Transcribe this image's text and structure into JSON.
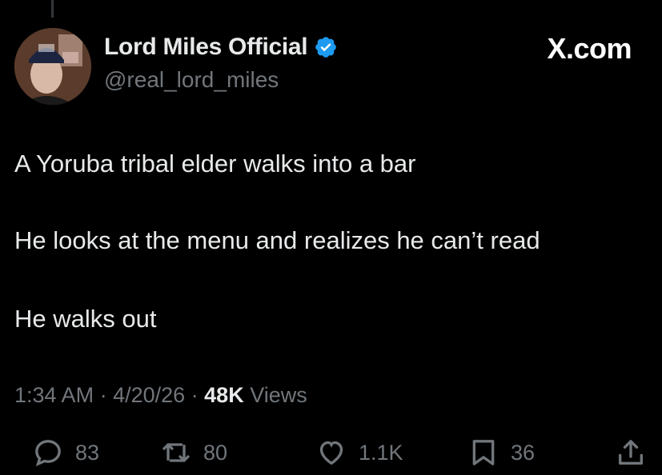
{
  "author": {
    "name": "Lord Miles Official",
    "handle": "@real_lord_miles",
    "verified": true
  },
  "site": {
    "label": "X.com"
  },
  "tweet": {
    "paragraphs": [
      "A Yoruba tribal elder walks into a bar",
      "He looks at the menu and realizes he can’t read",
      "He walks out"
    ],
    "time": "1:34 AM",
    "sep1": " · ",
    "date": "4/20/26",
    "sep2": " · ",
    "views_count": "48K",
    "views_label": " Views"
  },
  "actions": {
    "replies": "83",
    "retweets": "80",
    "likes": "1.1K",
    "bookmarks": "36"
  },
  "colors": {
    "background": "#000000",
    "text": "#e7e9ea",
    "muted": "#71767b",
    "verified": "#1d9bf0"
  },
  "icons": [
    "avatar",
    "verified-badge-icon",
    "reply-icon",
    "retweet-icon",
    "like-icon",
    "bookmark-icon",
    "share-icon"
  ]
}
